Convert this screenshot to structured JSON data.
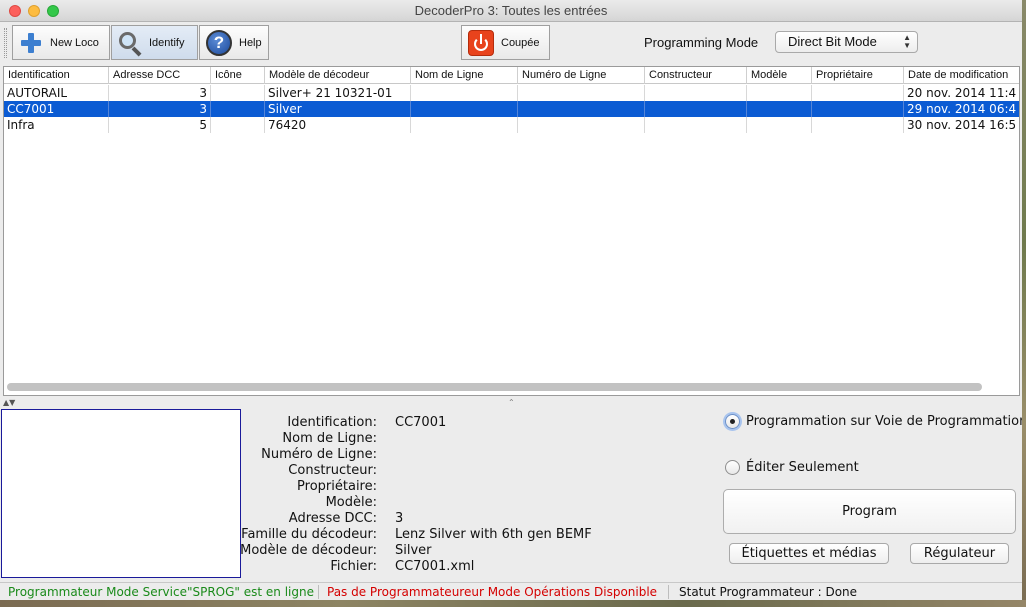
{
  "window": {
    "title": "DecoderPro 3: Toutes les entrées"
  },
  "toolbar": {
    "new_loco": "New Loco",
    "identify": "Identify",
    "help": "Help",
    "power": "Coupée",
    "programming_mode_label": "Programming Mode",
    "programming_mode_value": "Direct Bit Mode"
  },
  "table": {
    "columns": [
      "Identification",
      "Adresse DCC",
      "Icône",
      "Modèle de décodeur",
      "Nom de Ligne",
      "Numéro de Ligne",
      "Constructeur",
      "Modèle",
      "Propriétaire",
      "Date de modification"
    ],
    "rows": [
      {
        "id": "AUTORAIL",
        "address": "3",
        "icon": "",
        "model": "Silver+ 21 10321-01",
        "road_name": "",
        "road_number": "",
        "mfg": "",
        "loco_model": "",
        "owner": "",
        "date": "20 nov. 2014 11:4"
      },
      {
        "id": "CC7001",
        "address": "3",
        "icon": "",
        "model": "Silver",
        "road_name": "",
        "road_number": "",
        "mfg": "",
        "loco_model": "",
        "owner": "",
        "date": "29 nov. 2014 06:4"
      },
      {
        "id": "Infra",
        "address": "5",
        "icon": "",
        "model": "76420",
        "road_name": "",
        "road_number": "",
        "mfg": "",
        "loco_model": "",
        "owner": "",
        "date": "30 nov. 2014 16:5"
      }
    ],
    "selected_index": 1
  },
  "details": {
    "labels": {
      "identification": "Identification:",
      "road_name": "Nom de Ligne:",
      "road_number": "Numéro de Ligne:",
      "manufacturer": "Constructeur:",
      "owner": "Propriétaire:",
      "model": "Modèle:",
      "dcc_address": "Adresse DCC:",
      "decoder_family": "Famille du décodeur:",
      "decoder_model": "Modèle de décodeur:",
      "file": "Fichier:"
    },
    "values": {
      "identification": "CC7001",
      "road_name": "",
      "road_number": "",
      "manufacturer": "",
      "owner": "",
      "model": "",
      "dcc_address": "3",
      "decoder_family": "Lenz Silver with 6th gen BEMF",
      "decoder_model": "Silver",
      "file": "CC7001.xml"
    }
  },
  "options": {
    "programming_track": "Programmation sur Voie de Programmation",
    "edit_only": "Éditer Seulement",
    "selected": "programming_track"
  },
  "buttons": {
    "program": "Program",
    "labels_media": "Étiquettes et médias",
    "throttle": "Régulateur"
  },
  "status": {
    "service_mode": "Programmateur Mode Service\"SPROG\" est en ligne",
    "ops_mode": "Pas de Programmateureur Mode Opérations Disponible",
    "programmer_status": "Statut Programmateur : Done"
  },
  "colors": {
    "selection": "#0b5bd3",
    "status_ok": "#1a8a1a",
    "status_error": "#d40000",
    "power_button": "#e8431c"
  }
}
